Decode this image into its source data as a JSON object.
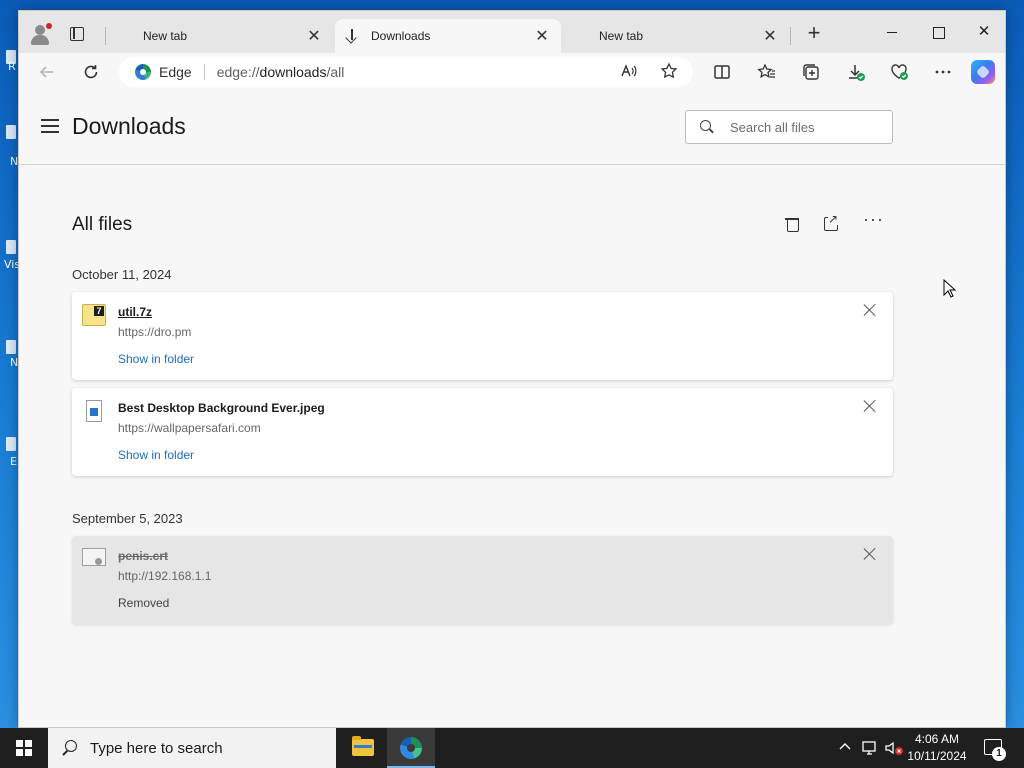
{
  "desktop": {
    "icon_labels": [
      "R",
      "N",
      "Vis",
      "N",
      "E"
    ]
  },
  "browser": {
    "tabs": [
      {
        "label": "New tab",
        "icon": "page-icon",
        "active": false
      },
      {
        "label": "Downloads",
        "icon": "download-icon",
        "active": true
      },
      {
        "label": "New tab",
        "icon": "page-icon",
        "active": false
      }
    ],
    "newtab_glyph": "+",
    "window_controls": {
      "close_glyph": "✕"
    },
    "address": {
      "site_label": "Edge",
      "url_scheme": "edge://",
      "url_host": "downloads",
      "url_path": "/all"
    },
    "toolbar_icons": [
      "back-icon",
      "refresh-icon",
      "read-aloud-icon",
      "favorite-star-icon",
      "split-screen-icon",
      "favorites-icon",
      "collections-icon",
      "downloads-icon",
      "browser-essentials-icon",
      "more-icon",
      "copilot-icon"
    ]
  },
  "downloads_page": {
    "title": "Downloads",
    "search_placeholder": "Search all files",
    "section_title": "All files",
    "more_glyph": "···",
    "groups": [
      {
        "date": "October 11, 2024",
        "items": [
          {
            "name": "util.7z",
            "source": "https://dro.pm",
            "action": "Show in folder",
            "status": "",
            "removed": false,
            "icon": "7z-archive-icon"
          },
          {
            "name": "Best Desktop Background Ever.jpeg",
            "source": "https://wallpapersafari.com",
            "action": "Show in folder",
            "status": "",
            "removed": false,
            "icon": "image-file-icon"
          }
        ]
      },
      {
        "date": "September 5, 2023",
        "items": [
          {
            "name": "penis.crt",
            "source": "http://192.168.1.1",
            "action": "",
            "status": "Removed",
            "removed": true,
            "icon": "certificate-file-icon"
          }
        ]
      }
    ]
  },
  "taskbar": {
    "search_placeholder": "Type here to search",
    "time": "4:06 AM",
    "date": "10/11/2024",
    "notification_count": "1",
    "apps": [
      "file-explorer-icon",
      "edge-icon"
    ]
  },
  "colors": {
    "link": "#1a6fb8",
    "desktop_bg": "#1a6fc4",
    "taskbar_bg": "#1f1f1f"
  }
}
